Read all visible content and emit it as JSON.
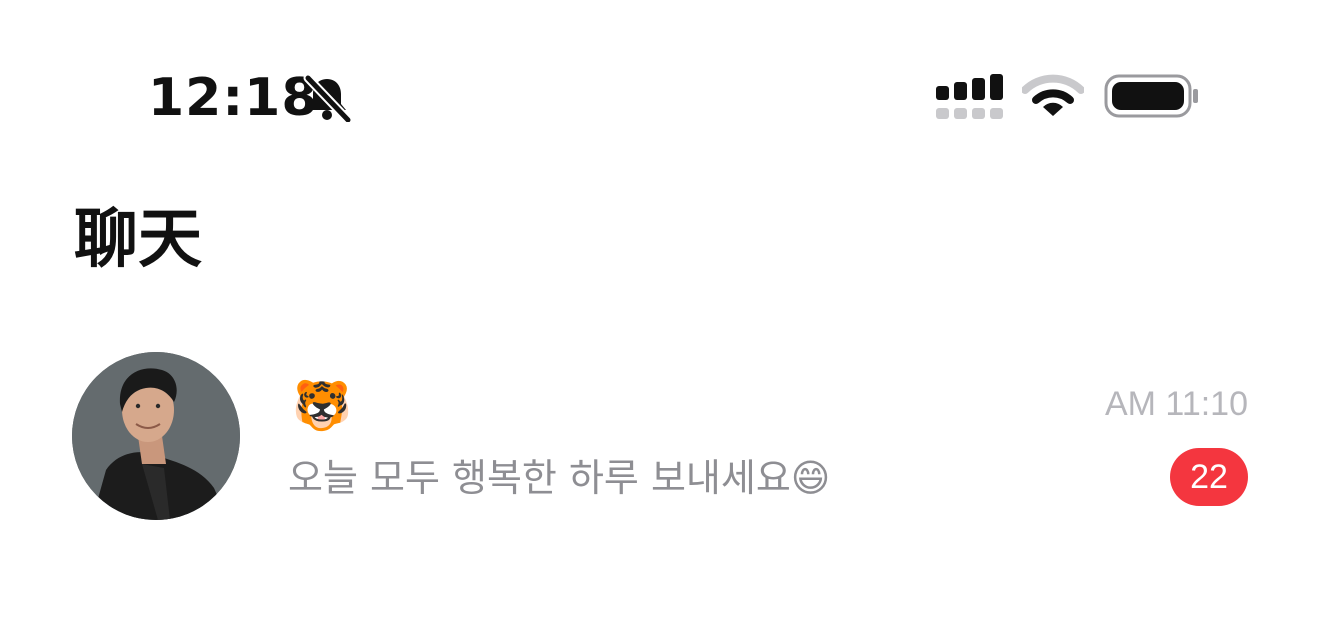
{
  "status_bar": {
    "time": "12:18",
    "icons": [
      "bell-slash-icon",
      "cellular-signal-icon",
      "wifi-icon",
      "battery-icon"
    ]
  },
  "page": {
    "title": "聊天"
  },
  "chats": [
    {
      "name": "🐯",
      "avatar": "avatar",
      "time": "AM 11:10",
      "preview": "오늘 모두 행복한 하루 보내세요😄",
      "unread": "22"
    }
  ],
  "colors": {
    "badge": "#f4363f",
    "secondary_text": "#8e8e93",
    "time_text": "#b6b6bb"
  }
}
